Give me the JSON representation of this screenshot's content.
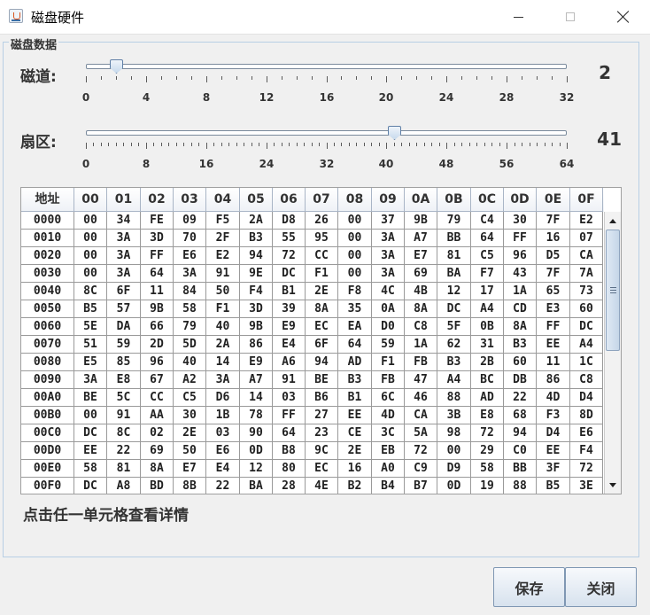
{
  "window": {
    "title": "磁盘硬件",
    "app_icon": "java-cup-icon"
  },
  "group": {
    "title": "磁盘数据"
  },
  "track_slider": {
    "label": "磁道:",
    "value": "2",
    "value_num": 2,
    "min": 0,
    "max": 32,
    "tick_labels": [
      "0",
      "4",
      "8",
      "12",
      "16",
      "20",
      "24",
      "28",
      "32"
    ]
  },
  "sector_slider": {
    "label": "扇区:",
    "value": "41",
    "value_num": 41,
    "min": 0,
    "max": 64,
    "tick_labels": [
      "0",
      "8",
      "16",
      "24",
      "32",
      "40",
      "48",
      "56",
      "64"
    ]
  },
  "table": {
    "headers": [
      "地址",
      "00",
      "01",
      "02",
      "03",
      "04",
      "05",
      "06",
      "07",
      "08",
      "09",
      "0A",
      "0B",
      "0C",
      "0D",
      "0E",
      "0F"
    ],
    "rows": [
      [
        "0000",
        "00",
        "34",
        "FE",
        "09",
        "F5",
        "2A",
        "D8",
        "26",
        "00",
        "37",
        "9B",
        "79",
        "C4",
        "30",
        "7F",
        "E2"
      ],
      [
        "0010",
        "00",
        "3A",
        "3D",
        "70",
        "2F",
        "B3",
        "55",
        "95",
        "00",
        "3A",
        "A7",
        "BB",
        "64",
        "FF",
        "16",
        "07"
      ],
      [
        "0020",
        "00",
        "3A",
        "FF",
        "E6",
        "E2",
        "94",
        "72",
        "CC",
        "00",
        "3A",
        "E7",
        "81",
        "C5",
        "96",
        "D5",
        "CA"
      ],
      [
        "0030",
        "00",
        "3A",
        "64",
        "3A",
        "91",
        "9E",
        "DC",
        "F1",
        "00",
        "3A",
        "69",
        "BA",
        "F7",
        "43",
        "7F",
        "7A"
      ],
      [
        "0040",
        "8C",
        "6F",
        "11",
        "84",
        "50",
        "F4",
        "B1",
        "2E",
        "F8",
        "4C",
        "4B",
        "12",
        "17",
        "1A",
        "65",
        "73"
      ],
      [
        "0050",
        "B5",
        "57",
        "9B",
        "58",
        "F1",
        "3D",
        "39",
        "8A",
        "35",
        "0A",
        "8A",
        "DC",
        "A4",
        "CD",
        "E3",
        "60"
      ],
      [
        "0060",
        "5E",
        "DA",
        "66",
        "79",
        "40",
        "9B",
        "E9",
        "EC",
        "EA",
        "D0",
        "C8",
        "5F",
        "0B",
        "8A",
        "FF",
        "DC"
      ],
      [
        "0070",
        "51",
        "59",
        "2D",
        "5D",
        "2A",
        "86",
        "E4",
        "6F",
        "64",
        "59",
        "1A",
        "62",
        "31",
        "B3",
        "EE",
        "A4"
      ],
      [
        "0080",
        "E5",
        "85",
        "96",
        "40",
        "14",
        "E9",
        "A6",
        "94",
        "AD",
        "F1",
        "FB",
        "B3",
        "2B",
        "60",
        "11",
        "1C"
      ],
      [
        "0090",
        "3A",
        "E8",
        "67",
        "A2",
        "3A",
        "A7",
        "91",
        "BE",
        "B3",
        "FB",
        "47",
        "A4",
        "BC",
        "DB",
        "86",
        "C8"
      ],
      [
        "00A0",
        "BE",
        "5C",
        "CC",
        "C5",
        "D6",
        "14",
        "03",
        "B6",
        "B1",
        "6C",
        "46",
        "88",
        "AD",
        "22",
        "4D",
        "D4"
      ],
      [
        "00B0",
        "00",
        "91",
        "AA",
        "30",
        "1B",
        "78",
        "FF",
        "27",
        "EE",
        "4D",
        "CA",
        "3B",
        "E8",
        "68",
        "F3",
        "8D"
      ],
      [
        "00C0",
        "DC",
        "8C",
        "02",
        "2E",
        "03",
        "90",
        "64",
        "23",
        "CE",
        "3C",
        "5A",
        "98",
        "72",
        "94",
        "D4",
        "E6"
      ],
      [
        "00D0",
        "EE",
        "22",
        "69",
        "50",
        "E6",
        "0D",
        "B8",
        "9C",
        "2E",
        "EB",
        "72",
        "00",
        "29",
        "C0",
        "EE",
        "F4"
      ],
      [
        "00E0",
        "58",
        "81",
        "8A",
        "E7",
        "E4",
        "12",
        "80",
        "EC",
        "16",
        "A0",
        "C9",
        "D9",
        "58",
        "BB",
        "3F",
        "72"
      ],
      [
        "00F0",
        "DC",
        "A8",
        "BD",
        "8B",
        "22",
        "BA",
        "28",
        "4E",
        "B2",
        "B4",
        "B7",
        "0D",
        "19",
        "88",
        "B5",
        "3E"
      ]
    ]
  },
  "hint": "点击任一单元格查看详情",
  "buttons": {
    "save": "保存",
    "close": "关闭"
  },
  "colors": {
    "accent": "#c7d9ec",
    "group_border": "#b8cfe5",
    "grid": "#9a9a9a"
  }
}
